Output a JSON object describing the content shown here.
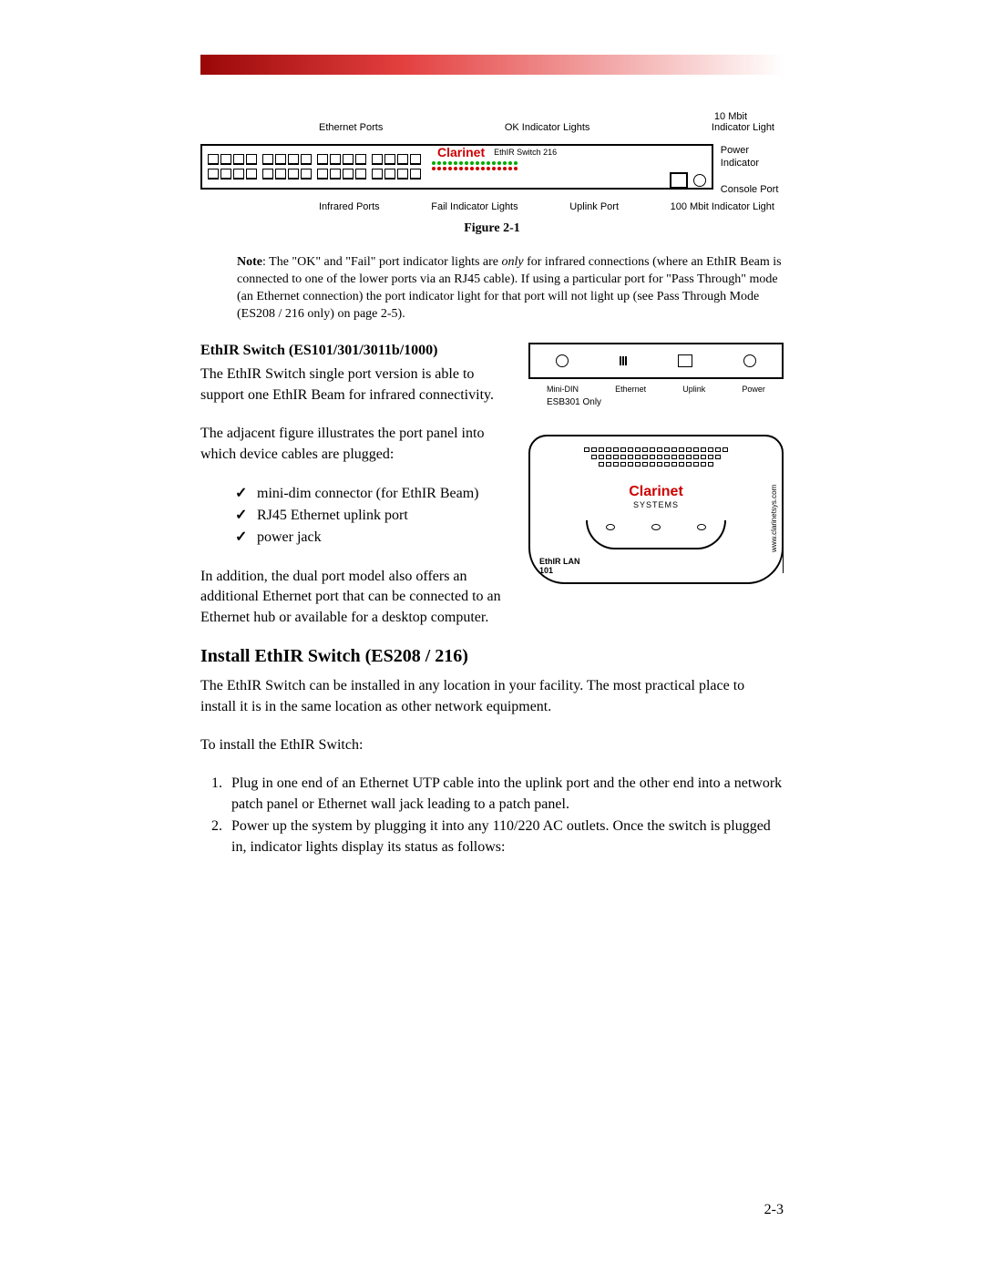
{
  "figure_216": {
    "top_labels": {
      "ethernet_ports": "Ethernet Ports",
      "ok_indicator": "OK Indicator Lights",
      "ten_mbit": "10 Mbit",
      "indicator_light": "Indicator Light"
    },
    "right_labels": {
      "power_indicator": "Power Indicator",
      "console_port": "Console Port"
    },
    "bottom_labels": {
      "infrared_ports": "Infrared Ports",
      "fail_indicator": "Fail Indicator Lights",
      "uplink_port": "Uplink Port",
      "hundred_mbit": "100 Mbit Indicator Light"
    },
    "brand": "Clarinet",
    "product": "EthIR Switch 216"
  },
  "figure_caption": "Figure 2-1",
  "note": {
    "label": "Note",
    "text1": ": The \"OK\" and \"Fail\" port indicator lights are ",
    "only": "only",
    "text2": " for infrared connections (where an EthIR Beam is connected to one of the lower ports via an RJ45 cable).  If using a particular port for \"Pass Through\" mode (an Ethernet connection) the port indicator light for that port will not light up (see Pass Through Mode (ES208 / 216 only) on page 2-5)."
  },
  "single_port": {
    "heading": "EthIR Switch (ES101/301/3011b/1000)",
    "para1": "The EthIR Switch single port version is able to support one EthIR Beam for infrared connectivity.",
    "para2": "The adjacent figure illustrates the port panel into which device cables are plugged:",
    "bullets": {
      "b1": "mini-dim connector (for EthIR Beam)",
      "b2": "RJ45 Ethernet uplink port",
      "b3": "power jack"
    },
    "para3": "In addition, the dual port model also offers an additional Ethernet port that can be connected to an Ethernet hub or available for a desktop computer."
  },
  "panel_fig": {
    "mini_din": "Mini-DIN",
    "ethernet": "Ethernet",
    "uplink": "Uplink",
    "power": "Power",
    "esb_note": "ESB301 Only"
  },
  "device_fig": {
    "brand": "Clarinet",
    "sub": "SYSTEMS",
    "model_line1": "EthIR LAN",
    "model_line2": "101",
    "side": "www.clarinetsys.com"
  },
  "install": {
    "heading": "Install EthIR Switch (ES208 / 216)",
    "para1": "The EthIR Switch can be installed in any location in your facility.  The most practical place to install it is in the same location as other network equipment.",
    "para2": "To install the EthIR Switch:",
    "steps": {
      "s1": "Plug in one end of an Ethernet UTP cable into the uplink port and the other end into a network patch panel or Ethernet wall jack leading to a patch panel.",
      "s2": "Power up the system by plugging it into any 110/220 AC outlets.  Once the switch is plugged in, indicator lights display its status as follows:"
    }
  },
  "page_number": "2-3"
}
